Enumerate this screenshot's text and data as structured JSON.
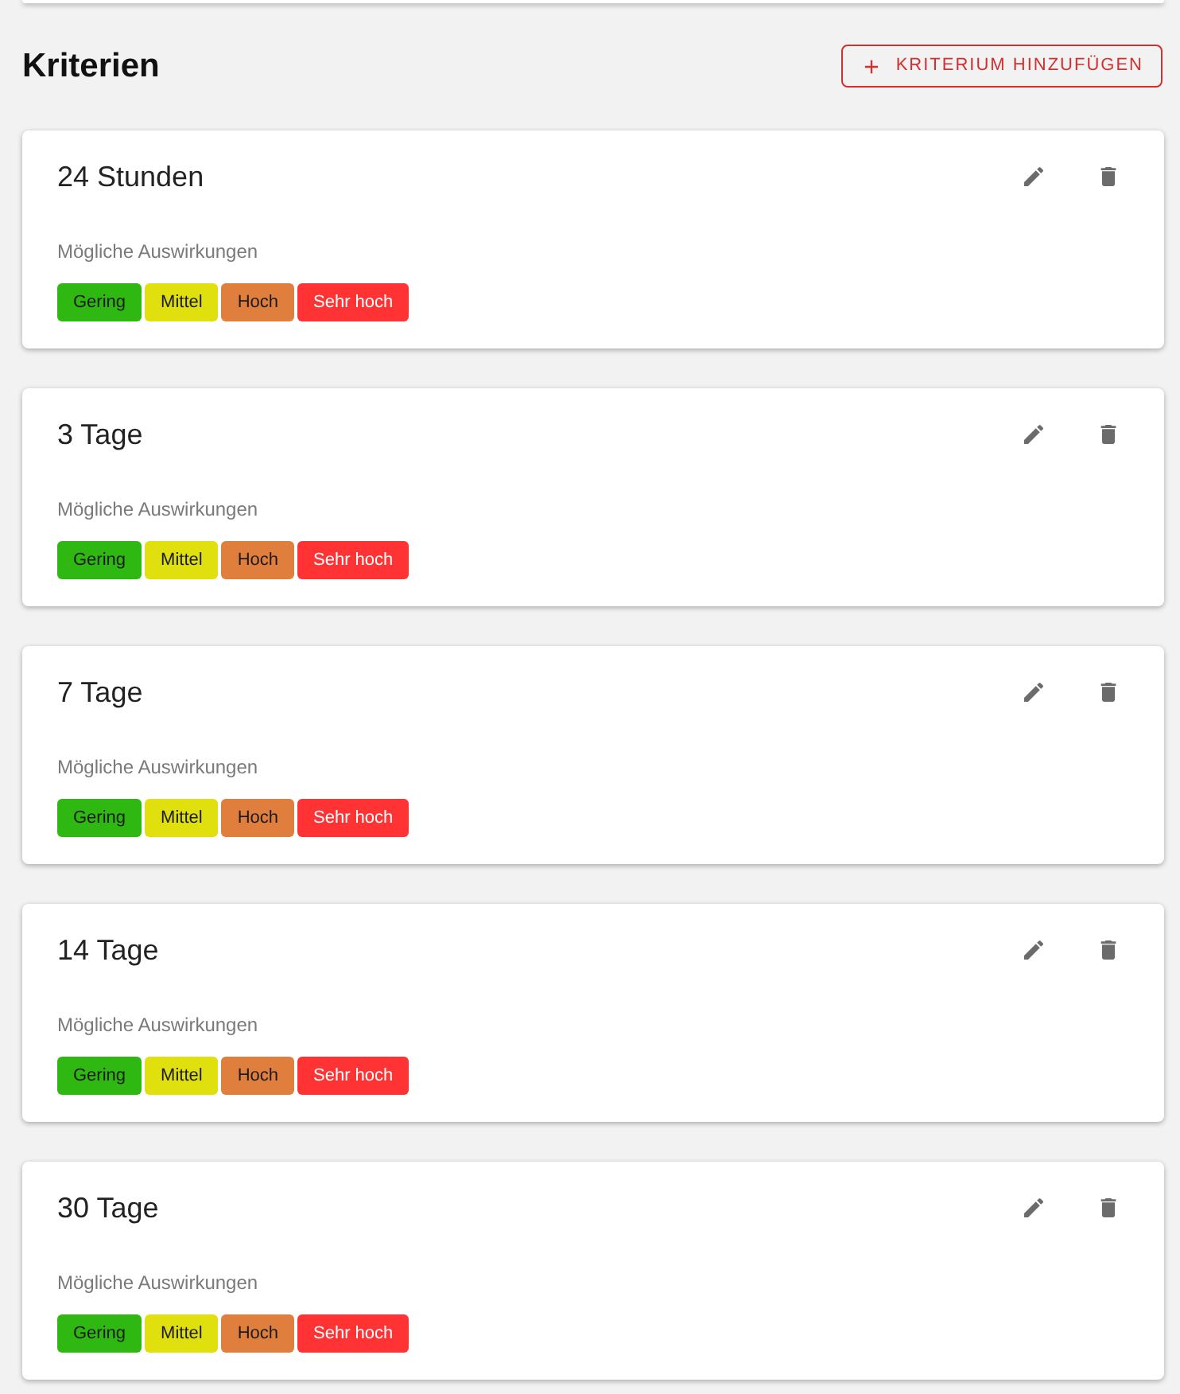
{
  "section": {
    "title": "Kriterien",
    "add_button": {
      "label": "KRITERIUM HINZUFÜGEN"
    }
  },
  "criteria": [
    {
      "title": "24 Stunden",
      "impacts_label": "Mögliche Auswirkungen",
      "impacts": [
        {
          "label": "Gering",
          "color": "#2fb812"
        },
        {
          "label": "Mittel",
          "color": "#e0e00e"
        },
        {
          "label": "Hoch",
          "color": "#e07f3d"
        },
        {
          "label": "Sehr hoch",
          "color": "#ff3333"
        }
      ]
    },
    {
      "title": "3 Tage",
      "impacts_label": "Mögliche Auswirkungen",
      "impacts": [
        {
          "label": "Gering",
          "color": "#2fb812"
        },
        {
          "label": "Mittel",
          "color": "#e0e00e"
        },
        {
          "label": "Hoch",
          "color": "#e07f3d"
        },
        {
          "label": "Sehr hoch",
          "color": "#ff3333"
        }
      ]
    },
    {
      "title": "7 Tage",
      "impacts_label": "Mögliche Auswirkungen",
      "impacts": [
        {
          "label": "Gering",
          "color": "#2fb812"
        },
        {
          "label": "Mittel",
          "color": "#e0e00e"
        },
        {
          "label": "Hoch",
          "color": "#e07f3d"
        },
        {
          "label": "Sehr hoch",
          "color": "#ff3333"
        }
      ]
    },
    {
      "title": "14 Tage",
      "impacts_label": "Mögliche Auswirkungen",
      "impacts": [
        {
          "label": "Gering",
          "color": "#2fb812"
        },
        {
          "label": "Mittel",
          "color": "#e0e00e"
        },
        {
          "label": "Hoch",
          "color": "#e07f3d"
        },
        {
          "label": "Sehr hoch",
          "color": "#ff3333"
        }
      ]
    },
    {
      "title": "30 Tage",
      "impacts_label": "Mögliche Auswirkungen",
      "impacts": [
        {
          "label": "Gering",
          "color": "#2fb812"
        },
        {
          "label": "Mittel",
          "color": "#e0e00e"
        },
        {
          "label": "Hoch",
          "color": "#e07f3d"
        },
        {
          "label": "Sehr hoch",
          "color": "#ff3333"
        }
      ]
    }
  ]
}
